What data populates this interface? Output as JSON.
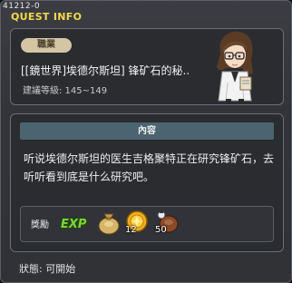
{
  "window": {
    "quest_id": "41212-0",
    "title": "QUEST INFO"
  },
  "quest": {
    "category_tag": "職業",
    "name": "[[鏡世界]埃德尔斯坦] 锋矿石的秘..",
    "level_range": "建議等級: 145~149",
    "npc_icon": "female-scientist-npc-portrait"
  },
  "content": {
    "header": "內容",
    "description": "听说埃德尔斯坦的医生吉格聚特正在研究锋矿石，去听听看到底是什么研究吧。"
  },
  "rewards": {
    "label": "獎勵",
    "items": [
      {
        "icon": "exp-icon",
        "text": "EXP"
      },
      {
        "icon": "meso-bag-icon",
        "quantity": ""
      },
      {
        "icon": "gold-coin-icon",
        "quantity": "12"
      },
      {
        "icon": "potion-bag-icon",
        "quantity": "50"
      }
    ]
  },
  "status": {
    "text": "狀態: 可開始"
  },
  "colors": {
    "title": "#f4d84a",
    "section_header": "#4c6470",
    "exp_text": "#7fd23a"
  }
}
